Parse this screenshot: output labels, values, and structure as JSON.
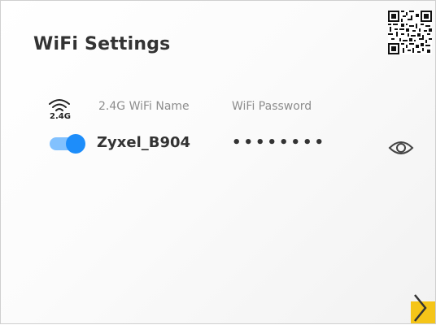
{
  "title": "WiFi Settings",
  "band": {
    "label": "2.4G",
    "name_header": "2.4G WiFi Name",
    "password_header": "WiFi Password"
  },
  "network": {
    "ssid": "Zyxel_B904",
    "password_masked": "••••••••",
    "enabled": true
  },
  "icons": {
    "wifi": "wifi-icon",
    "qr": "qr-code-icon",
    "eye": "eye-icon",
    "next": "chevron-right-icon"
  },
  "colors": {
    "accent": "#1d8dfa",
    "next_button": "#f5c518",
    "title": "#333333",
    "header": "#8c8c8c"
  }
}
